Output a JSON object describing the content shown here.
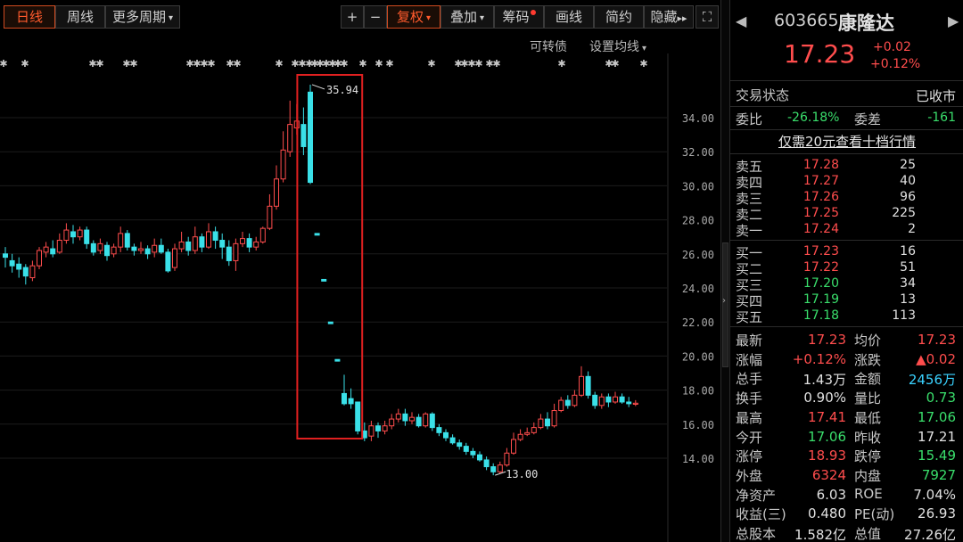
{
  "toolbar": {
    "period_daily": "日线",
    "period_weekly": "周线",
    "more_periods": "更多周期",
    "zoom_in": "+",
    "zoom_out": "−",
    "adjust": "复权",
    "overlay": "叠加",
    "chips": "筹码",
    "draw": "画线",
    "simple": "简约",
    "hide": "隐藏",
    "fullscreen": "⛶"
  },
  "chart": {
    "convertible_link": "可转债",
    "set_ma_link": "设置均线",
    "annotations": {
      "high": "35.94",
      "low": "13.00"
    },
    "highlight_color": "#e02020"
  },
  "chart_data": {
    "type": "candlestick",
    "y_ticks": [
      "14.00",
      "16.00",
      "18.00",
      "20.00",
      "22.00",
      "24.00",
      "26.00",
      "28.00",
      "30.00",
      "32.00",
      "34.00"
    ],
    "ylim": [
      12.5,
      36.5
    ],
    "up_color": "#ff4d4d",
    "down_color": "#3ae0e8",
    "candles": [
      [
        26.0,
        25.8,
        26.4,
        25.2
      ],
      [
        25.6,
        25.3,
        26.0,
        24.9
      ],
      [
        25.4,
        25.1,
        25.8,
        24.6
      ],
      [
        25.2,
        24.7,
        25.4,
        24.2
      ],
      [
        24.6,
        25.3,
        25.6,
        24.4
      ],
      [
        25.3,
        26.2,
        26.4,
        25.1
      ],
      [
        26.1,
        26.4,
        26.7,
        25.8
      ],
      [
        26.3,
        26.0,
        26.8,
        25.8
      ],
      [
        26.1,
        26.8,
        27.2,
        26.0
      ],
      [
        26.8,
        27.4,
        27.8,
        26.6
      ],
      [
        27.3,
        27.0,
        27.7,
        26.6
      ],
      [
        27.0,
        27.4,
        27.6,
        26.8
      ],
      [
        27.4,
        26.6,
        27.6,
        26.3
      ],
      [
        26.6,
        26.1,
        26.8,
        25.9
      ],
      [
        26.2,
        26.6,
        26.9,
        26.0
      ],
      [
        26.5,
        25.9,
        26.7,
        25.6
      ],
      [
        26.0,
        26.4,
        26.6,
        25.8
      ],
      [
        26.4,
        27.2,
        27.6,
        26.1
      ],
      [
        27.2,
        26.4,
        27.4,
        26.2
      ],
      [
        26.4,
        26.2,
        26.6,
        25.9
      ],
      [
        26.2,
        26.3,
        26.7,
        26.0
      ],
      [
        26.3,
        26.0,
        26.5,
        25.7
      ],
      [
        26.1,
        26.5,
        26.9,
        25.8
      ],
      [
        26.5,
        26.1,
        26.9,
        26.0
      ],
      [
        26.1,
        25.0,
        26.3,
        24.9
      ],
      [
        25.2,
        26.3,
        26.6,
        25.0
      ],
      [
        26.3,
        26.7,
        27.3,
        26.1
      ],
      [
        26.7,
        26.2,
        27.0,
        25.9
      ],
      [
        26.2,
        27.0,
        27.6,
        26.0
      ],
      [
        27.0,
        26.4,
        27.2,
        26.1
      ],
      [
        26.4,
        27.3,
        27.8,
        26.3
      ],
      [
        27.3,
        26.8,
        27.6,
        26.3
      ],
      [
        26.8,
        26.4,
        27.2,
        25.7
      ],
      [
        26.4,
        25.6,
        26.8,
        25.3
      ],
      [
        25.6,
        26.6,
        26.9,
        25.0
      ],
      [
        26.6,
        26.9,
        27.3,
        26.4
      ],
      [
        26.9,
        26.4,
        27.2,
        26.1
      ],
      [
        26.4,
        26.7,
        27.0,
        26.2
      ],
      [
        26.7,
        27.5,
        27.6,
        26.6
      ],
      [
        27.5,
        28.8,
        29.5,
        27.4
      ],
      [
        28.8,
        30.4,
        31.2,
        28.6
      ],
      [
        30.4,
        32.1,
        33.2,
        30.2
      ],
      [
        32.0,
        33.6,
        35.0,
        31.7
      ],
      [
        33.4,
        33.8,
        34.8,
        33.0
      ],
      [
        33.6,
        32.3,
        34.6,
        31.8
      ],
      [
        35.5,
        30.2,
        35.94,
        30.1
      ],
      [
        27.2,
        27.1,
        27.2,
        27.1
      ],
      [
        24.5,
        24.4,
        24.5,
        24.4
      ],
      [
        22.0,
        21.9,
        22.0,
        21.9
      ],
      [
        19.8,
        19.7,
        19.8,
        19.7
      ],
      [
        17.8,
        17.2,
        18.9,
        17.1
      ],
      [
        17.5,
        17.2,
        18.1,
        16.9
      ],
      [
        17.3,
        15.6,
        17.3,
        15.4
      ],
      [
        15.6,
        15.2,
        16.1,
        15.0
      ],
      [
        15.3,
        15.9,
        16.2,
        15.0
      ],
      [
        15.9,
        15.6,
        16.1,
        15.2
      ],
      [
        15.6,
        15.9,
        16.2,
        15.4
      ],
      [
        15.9,
        16.3,
        16.6,
        15.7
      ],
      [
        16.3,
        16.6,
        16.9,
        16.1
      ],
      [
        16.6,
        16.2,
        16.9,
        15.9
      ],
      [
        16.2,
        16.4,
        16.7,
        16.0
      ],
      [
        16.4,
        15.9,
        16.6,
        15.8
      ],
      [
        15.9,
        16.6,
        16.7,
        15.8
      ],
      [
        16.6,
        15.8,
        16.7,
        15.6
      ],
      [
        15.8,
        15.5,
        16.0,
        15.3
      ],
      [
        15.5,
        15.2,
        15.7,
        15.0
      ],
      [
        15.2,
        14.9,
        15.4,
        14.8
      ],
      [
        14.9,
        14.7,
        15.1,
        14.5
      ],
      [
        14.7,
        14.4,
        14.9,
        14.2
      ],
      [
        14.4,
        14.2,
        14.6,
        14.0
      ],
      [
        14.2,
        13.9,
        14.4,
        13.8
      ],
      [
        13.9,
        13.5,
        14.1,
        13.3
      ],
      [
        13.5,
        13.2,
        13.7,
        13.0
      ],
      [
        13.2,
        13.6,
        13.8,
        13.1
      ],
      [
        13.6,
        14.3,
        14.6,
        13.5
      ],
      [
        14.3,
        15.1,
        15.5,
        14.2
      ],
      [
        15.1,
        15.4,
        15.7,
        15.0
      ],
      [
        15.4,
        15.5,
        15.8,
        15.3
      ],
      [
        15.5,
        15.8,
        16.1,
        15.4
      ],
      [
        15.8,
        16.3,
        16.6,
        15.7
      ],
      [
        16.3,
        15.9,
        16.7,
        15.7
      ],
      [
        15.9,
        16.8,
        17.2,
        15.8
      ],
      [
        16.8,
        17.4,
        17.6,
        16.7
      ],
      [
        17.4,
        17.1,
        17.7,
        16.9
      ],
      [
        17.1,
        17.7,
        18.0,
        17.0
      ],
      [
        17.7,
        18.8,
        19.4,
        17.6
      ],
      [
        18.8,
        17.7,
        19.1,
        17.5
      ],
      [
        17.7,
        17.1,
        17.9,
        16.9
      ],
      [
        17.1,
        17.6,
        17.8,
        16.9
      ],
      [
        17.6,
        17.3,
        17.8,
        17.0
      ],
      [
        17.3,
        17.6,
        17.9,
        17.2
      ],
      [
        17.6,
        17.3,
        17.8,
        17.2
      ],
      [
        17.3,
        17.2,
        17.6,
        17.0
      ],
      [
        17.2,
        17.23,
        17.41,
        17.06
      ]
    ],
    "marker_glyphs": "✱"
  },
  "quote": {
    "code": "603665",
    "name": "康隆达",
    "price": "17.23",
    "change": "+0.02",
    "change_pct": "+0.12%",
    "status_label": "交易状态",
    "status_value": "已收市",
    "ratio_label": "委比",
    "ratio_value": "-26.18%",
    "diff_label": "委差",
    "diff_value": "-161",
    "promo_link": "仅需20元查看十档行情",
    "asks": [
      {
        "label": "卖五",
        "price": "17.28",
        "vol": "25"
      },
      {
        "label": "卖四",
        "price": "17.27",
        "vol": "40"
      },
      {
        "label": "卖三",
        "price": "17.26",
        "vol": "96"
      },
      {
        "label": "卖二",
        "price": "17.25",
        "vol": "225"
      },
      {
        "label": "卖一",
        "price": "17.24",
        "vol": "2"
      }
    ],
    "bids": [
      {
        "label": "买一",
        "price": "17.23",
        "vol": "16"
      },
      {
        "label": "买二",
        "price": "17.22",
        "vol": "51"
      },
      {
        "label": "买三",
        "price": "17.20",
        "vol": "34"
      },
      {
        "label": "买四",
        "price": "17.19",
        "vol": "13"
      },
      {
        "label": "买五",
        "price": "17.18",
        "vol": "113"
      }
    ],
    "stats": [
      {
        "l1": "最新",
        "v1": "17.23",
        "c1": "red",
        "l2": "均价",
        "v2": "17.23",
        "c2": "red"
      },
      {
        "l1": "涨幅",
        "v1": "+0.12%",
        "c1": "red",
        "l2": "涨跌",
        "v2": "▲0.02",
        "c2": "red"
      },
      {
        "l1": "总手",
        "v1": "1.43万",
        "c1": "white",
        "l2": "金额",
        "v2": "2456万",
        "c2": "cyan"
      },
      {
        "l1": "换手",
        "v1": "0.90%",
        "c1": "white",
        "l2": "量比",
        "v2": "0.73",
        "c2": "green"
      },
      {
        "l1": "最高",
        "v1": "17.41",
        "c1": "red",
        "l2": "最低",
        "v2": "17.06",
        "c2": "green"
      },
      {
        "l1": "今开",
        "v1": "17.06",
        "c1": "green",
        "l2": "昨收",
        "v2": "17.21",
        "c2": "white"
      },
      {
        "l1": "涨停",
        "v1": "18.93",
        "c1": "red",
        "l2": "跌停",
        "v2": "15.49",
        "c2": "green"
      },
      {
        "l1": "外盘",
        "v1": "6324",
        "c1": "red",
        "l2": "内盘",
        "v2": "7927",
        "c2": "green"
      },
      {
        "l1": "净资产",
        "v1": "6.03",
        "c1": "white",
        "l2": "ROE",
        "v2": "7.04%",
        "c2": "white"
      },
      {
        "l1": "收益(三)",
        "v1": "0.480",
        "c1": "white",
        "l2": "PE(动)",
        "v2": "26.93",
        "c2": "white"
      },
      {
        "l1": "总股本",
        "v1": "1.582亿",
        "c1": "white",
        "l2": "总值",
        "v2": "27.26亿",
        "c2": "white"
      }
    ]
  }
}
